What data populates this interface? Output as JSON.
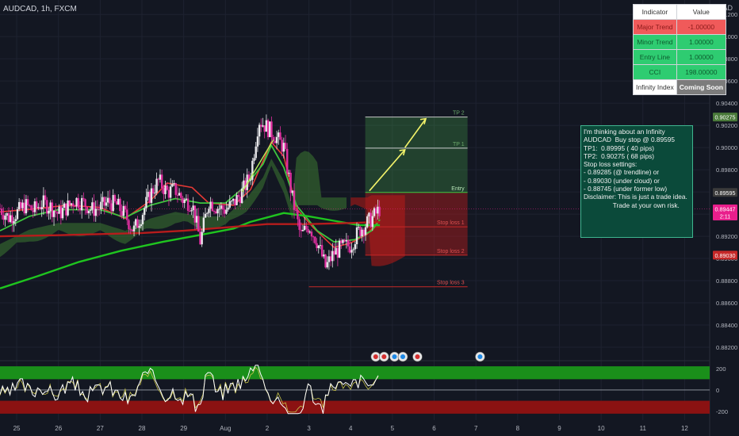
{
  "header": {
    "symbol": "AUDCAD, 1h, FXCM",
    "currency": "CAD"
  },
  "indicator_table": {
    "header": {
      "indicator": "Indicator",
      "value": "Value"
    },
    "rows": [
      {
        "indicator": "Major Trend",
        "value": "-1.00000",
        "bg": "#f05a5a",
        "fg": "#8b1a1a"
      },
      {
        "indicator": "Minor Trend",
        "value": "1.00000",
        "bg": "#2ecc71",
        "fg": "#0e5a2e"
      },
      {
        "indicator": "Entry Line",
        "value": "1.00000",
        "bg": "#2ecc71",
        "fg": "#0e5a2e"
      },
      {
        "indicator": "CCI",
        "value": "198.00000",
        "bg": "#2ecc71",
        "fg": "#0e5a2e"
      },
      {
        "indicator": "Infinity Index",
        "value": "Coming Soon",
        "bg": "#ffffff",
        "fg": "#333333",
        "value_bg": "#7c7c7c",
        "value_fg": "#ffffff"
      }
    ]
  },
  "note_lines": [
    "I'm thinking about an Infinity",
    "AUDCAD  Buy stop @ 0.89595",
    "",
    "TP1:  0.89995 ( 40 pips)",
    "TP2:  0.90275 ( 68 pips)",
    "",
    "Stop loss settings:",
    "- 0.89285 (@ trendline) or",
    "- 0.89030 (under cloud) or",
    "- 0.88745 (under former low)",
    "",
    "Disclaimer: This is just a trade idea.",
    "                Trade at your own risk."
  ],
  "chart_data": {
    "type": "line",
    "title": "AUDCAD, 1h, FXCM",
    "currency": "CAD",
    "x_axis": {
      "tick_labels": [
        "25",
        "26",
        "27",
        "28",
        "29",
        "Aug",
        "2",
        "3",
        "4",
        "5",
        "6",
        "7",
        "8",
        "9",
        "10",
        "11",
        "12"
      ],
      "tick_days": [
        0,
        1,
        2,
        3,
        4,
        5,
        6,
        7,
        8,
        9,
        10,
        11,
        12,
        13,
        14,
        15,
        16
      ],
      "range_days": [
        -0.4,
        16.6
      ]
    },
    "y_axis": {
      "range": [
        0.881,
        0.9133
      ],
      "ticks": [
        0.912,
        0.91,
        0.908,
        0.906,
        0.904,
        0.902,
        0.9,
        0.898,
        0.896,
        0.894,
        0.892,
        0.89,
        0.888,
        0.886,
        0.884,
        0.882
      ],
      "tick_labels": [
        "0.91200",
        "0.91000",
        "0.90800",
        "0.90600",
        "0.90400",
        "0.90200",
        "0.90000",
        "0.89800",
        "0.89600",
        "0.89400",
        "0.89200",
        "0.89000",
        "0.88800",
        "0.88600",
        "0.88400",
        "0.88200"
      ]
    },
    "price_badges": [
      {
        "label": "0.90275",
        "value": 0.90275,
        "bg": "#4a7a3a",
        "fg": "#ffffff"
      },
      {
        "label": "0.89595",
        "value": 0.89595,
        "bg": "#3b3b3b",
        "fg": "#ffffff"
      },
      {
        "label": "0.89447",
        "sublabel": "2:11",
        "value": 0.89447,
        "bg": "#e91e8c",
        "fg": "#ffffff"
      },
      {
        "label": "0.89030",
        "value": 0.8903,
        "bg": "#c62828",
        "fg": "#ffffff"
      }
    ],
    "series": [
      {
        "name": "price",
        "color": "#e02fa0",
        "points": [
          [
            -0.4,
            0.8945
          ],
          [
            -0.2,
            0.8937
          ],
          [
            0.0,
            0.8941
          ],
          [
            0.2,
            0.8948
          ],
          [
            0.4,
            0.8943
          ],
          [
            0.6,
            0.895
          ],
          [
            0.8,
            0.8947
          ],
          [
            1.0,
            0.894
          ],
          [
            1.2,
            0.8946
          ],
          [
            1.4,
            0.8953
          ],
          [
            1.6,
            0.895
          ],
          [
            1.8,
            0.8944
          ],
          [
            2.0,
            0.8946
          ],
          [
            2.2,
            0.8951
          ],
          [
            2.4,
            0.8948
          ],
          [
            2.6,
            0.8939
          ],
          [
            2.8,
            0.8925
          ],
          [
            3.0,
            0.894
          ],
          [
            3.2,
            0.8958
          ],
          [
            3.4,
            0.897
          ],
          [
            3.6,
            0.896
          ],
          [
            3.8,
            0.8962
          ],
          [
            4.0,
            0.8952
          ],
          [
            4.2,
            0.895
          ],
          [
            4.4,
            0.8915
          ],
          [
            4.6,
            0.8952
          ],
          [
            4.8,
            0.8946
          ],
          [
            5.0,
            0.8944
          ],
          [
            5.2,
            0.895
          ],
          [
            5.4,
            0.896
          ],
          [
            5.6,
            0.8975
          ],
          [
            5.8,
            0.9025
          ],
          [
            6.0,
            0.9018
          ],
          [
            6.2,
            0.901
          ],
          [
            6.4,
            0.9
          ],
          [
            6.6,
            0.8955
          ],
          [
            6.8,
            0.892
          ],
          [
            7.0,
            0.893
          ],
          [
            7.2,
            0.8915
          ],
          [
            7.4,
            0.8892
          ],
          [
            7.6,
            0.8905
          ],
          [
            7.8,
            0.891
          ],
          [
            8.0,
            0.8912
          ],
          [
            8.2,
            0.8925
          ],
          [
            8.4,
            0.8932
          ],
          [
            8.6,
            0.894
          ],
          [
            8.7,
            0.8945
          ]
        ]
      },
      {
        "name": "fast-ma",
        "color": "#e53935",
        "points": [
          [
            -0.4,
            0.8942
          ],
          [
            0.5,
            0.8945
          ],
          [
            1.2,
            0.8948
          ],
          [
            2.0,
            0.8946
          ],
          [
            2.6,
            0.8936
          ],
          [
            3.2,
            0.8952
          ],
          [
            3.6,
            0.8968
          ],
          [
            4.2,
            0.8964
          ],
          [
            4.6,
            0.895
          ],
          [
            5.2,
            0.8948
          ],
          [
            5.6,
            0.8962
          ],
          [
            6.1,
            0.9005
          ],
          [
            6.4,
            0.8992
          ],
          [
            6.7,
            0.8945
          ],
          [
            7.1,
            0.8928
          ],
          [
            7.6,
            0.891
          ],
          [
            8.0,
            0.8914
          ],
          [
            8.4,
            0.8922
          ],
          [
            8.7,
            0.8935
          ]
        ]
      },
      {
        "name": "green-ma",
        "color": "#3ec43e",
        "points": [
          [
            -0.4,
            0.8925
          ],
          [
            0.3,
            0.8938
          ],
          [
            1.0,
            0.8944
          ],
          [
            2.0,
            0.8944
          ],
          [
            2.6,
            0.8937
          ],
          [
            3.2,
            0.8948
          ],
          [
            3.8,
            0.8954
          ],
          [
            4.4,
            0.895
          ],
          [
            5.0,
            0.895
          ],
          [
            5.5,
            0.8966
          ],
          [
            5.9,
            0.8985
          ],
          [
            6.1,
            0.9002
          ],
          [
            6.4,
            0.8982
          ],
          [
            6.7,
            0.8948
          ],
          [
            7.2,
            0.8925
          ],
          [
            7.6,
            0.8915
          ],
          [
            8.1,
            0.8917
          ],
          [
            8.5,
            0.8925
          ],
          [
            8.7,
            0.8935
          ]
        ]
      },
      {
        "name": "slow-ma",
        "color": "#1fc41f",
        "points": [
          [
            -0.4,
            0.8873
          ],
          [
            0.5,
            0.8884
          ],
          [
            1.5,
            0.8897
          ],
          [
            2.5,
            0.8907
          ],
          [
            3.5,
            0.8915
          ],
          [
            4.5,
            0.8922
          ],
          [
            5.2,
            0.8927
          ],
          [
            5.6,
            0.8933
          ],
          [
            6.0,
            0.8937
          ],
          [
            6.4,
            0.8941
          ],
          [
            7.0,
            0.8938
          ],
          [
            7.6,
            0.8934
          ],
          [
            8.2,
            0.893
          ],
          [
            8.7,
            0.893
          ]
        ]
      },
      {
        "name": "major-ma",
        "color": "#b71c1c",
        "points": [
          [
            -0.4,
            0.892
          ],
          [
            1.0,
            0.8921
          ],
          [
            2.0,
            0.8922
          ],
          [
            3.0,
            0.8923
          ],
          [
            4.0,
            0.8925
          ],
          [
            5.0,
            0.8928
          ],
          [
            6.0,
            0.8931
          ],
          [
            7.0,
            0.8931
          ],
          [
            8.0,
            0.8932
          ],
          [
            8.7,
            0.8933
          ]
        ]
      }
    ],
    "levels": [
      {
        "label": "TP 2",
        "value": 0.90275
      },
      {
        "label": "TP 1",
        "value": 0.89995
      },
      {
        "label": "Entry",
        "value": 0.89595
      },
      {
        "label": "Stop loss 1",
        "value": 0.89285
      },
      {
        "label": "Stop loss 2",
        "value": 0.8903
      },
      {
        "label": "Stop loss 3",
        "value": 0.88745
      }
    ],
    "oscillator": {
      "ticks": [
        200,
        0,
        -200
      ],
      "tick_labels": [
        "200",
        "0",
        "-200"
      ],
      "range": [
        -280,
        250
      ],
      "zone_upper": [
        100,
        220
      ],
      "zone_lower": [
        -220,
        -100
      ]
    }
  }
}
